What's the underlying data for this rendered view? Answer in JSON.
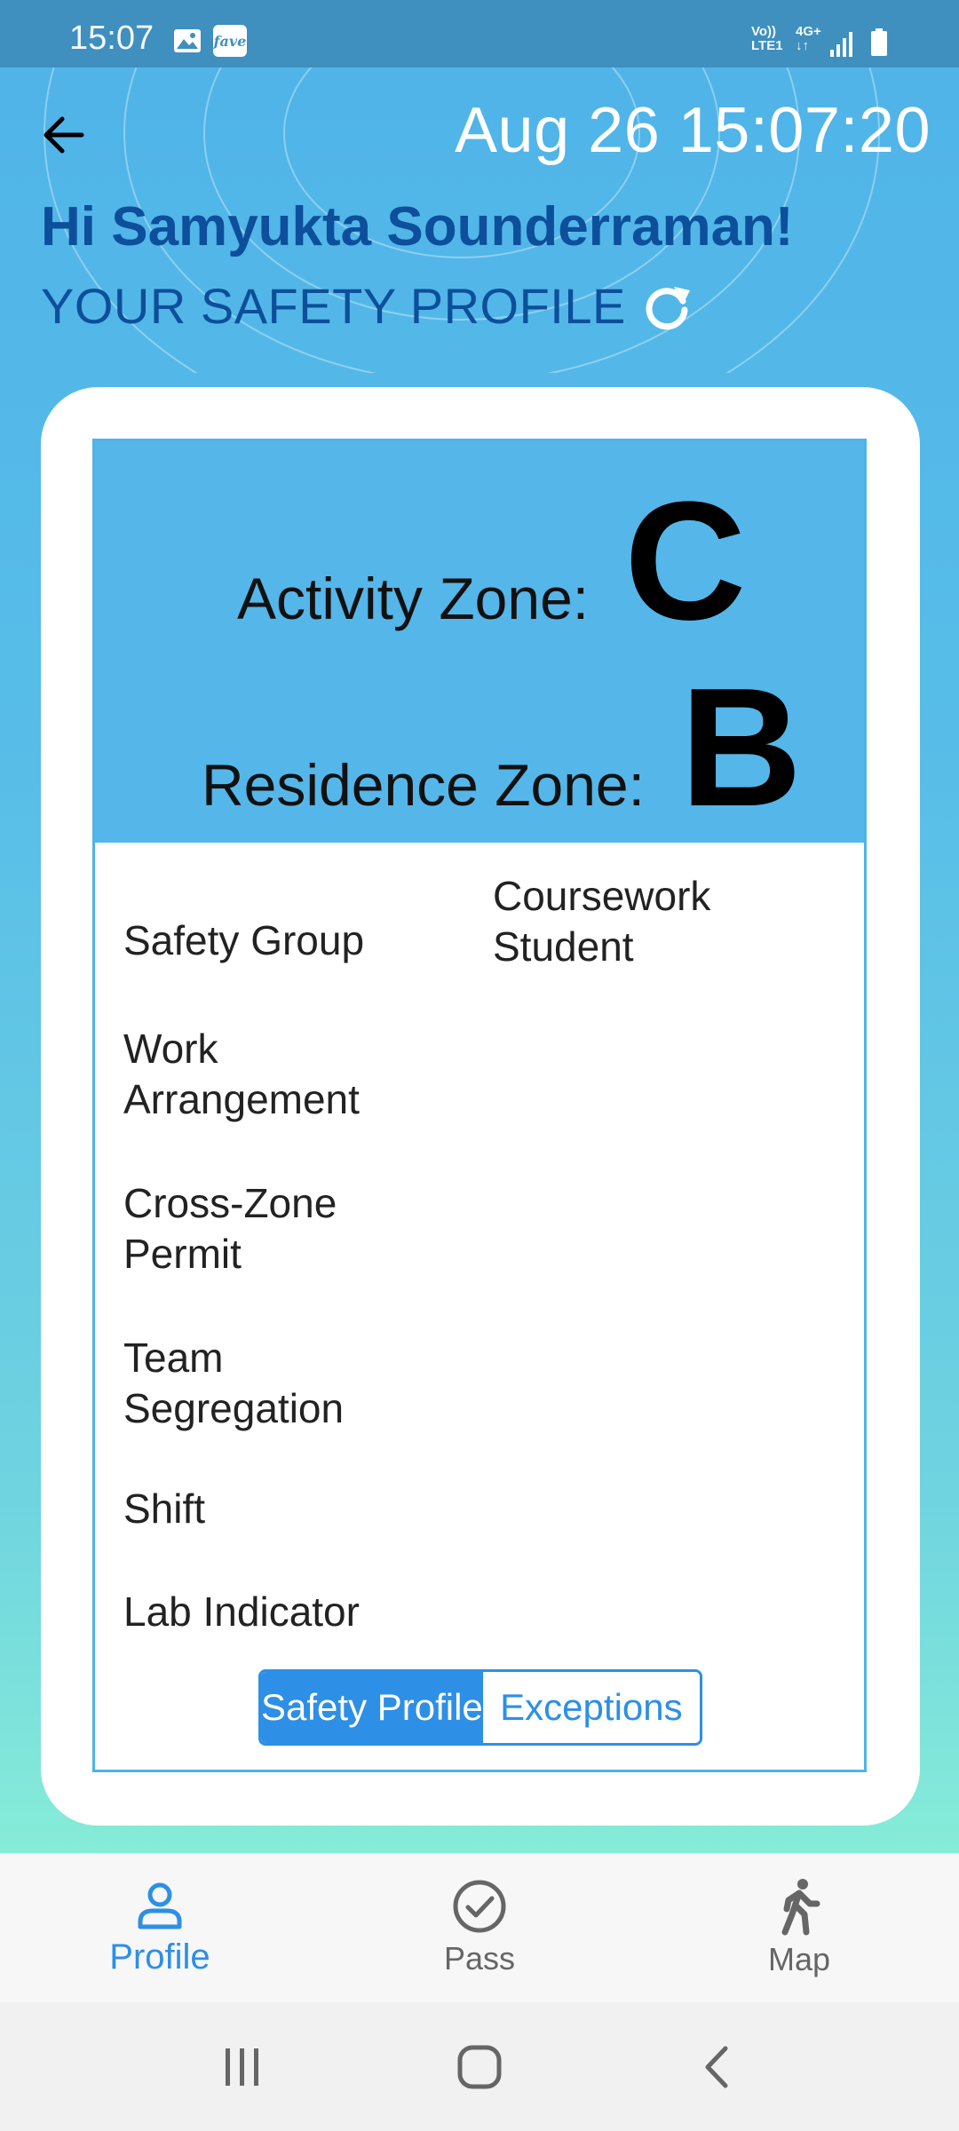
{
  "status_bar": {
    "time": "15:07",
    "fave_label": "fave",
    "network_line1": "Vo))\nLTE1",
    "network_line2": "4G+\n↓↑"
  },
  "header": {
    "datetime": "Aug 26 15:07:20",
    "greeting": "Hi Samyukta Sounderraman!",
    "subtitle": "YOUR SAFETY PROFILE"
  },
  "zones": {
    "activity_label": "Activity Zone:",
    "activity_value": "C",
    "residence_label": "Residence Zone:",
    "residence_value": "B"
  },
  "attributes": [
    {
      "label": "Safety Group",
      "value": "Coursework\nStudent"
    },
    {
      "label": "Work\nArrangement",
      "value": ""
    },
    {
      "label": "Cross-Zone\nPermit",
      "value": ""
    },
    {
      "label": "Team\nSegregation",
      "value": ""
    },
    {
      "label": "Shift",
      "value": ""
    },
    {
      "label": "Lab Indicator",
      "value": ""
    }
  ],
  "segmented": {
    "active_label": "Safety Profile",
    "inactive_label": "Exceptions"
  },
  "bottom_nav": [
    {
      "label": "Profile",
      "icon": "person-icon",
      "active": true
    },
    {
      "label": "Pass",
      "icon": "check-circle-icon",
      "active": false
    },
    {
      "label": "Map",
      "icon": "walking-icon",
      "active": false
    }
  ],
  "colors": {
    "accent": "#2d8fe6",
    "zone_panel": "#55b6e9",
    "heading": "#0d4f9a"
  }
}
